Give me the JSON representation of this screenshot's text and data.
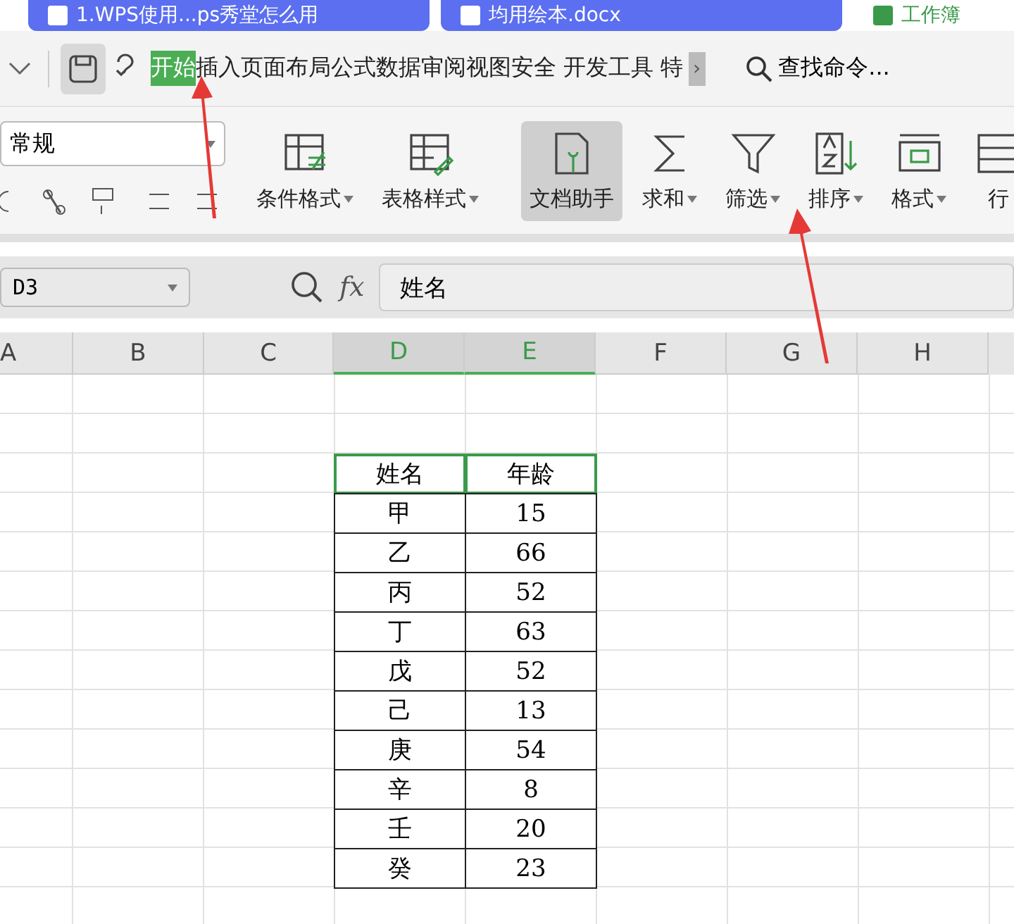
{
  "doc_tabs": [
    {
      "title": "1.WPS使用...ps秀堂怎么用",
      "kind": "writer",
      "selected": false
    },
    {
      "title": "均用绘本.docx",
      "kind": "writer",
      "selected": false
    },
    {
      "title": "工作簿",
      "kind": "sheet",
      "selected": true
    }
  ],
  "menu": [
    {
      "label": "开始",
      "selected": true
    },
    {
      "label": "插入",
      "selected": false
    },
    {
      "label": "页面布局",
      "selected": false
    },
    {
      "label": "公式",
      "selected": false
    },
    {
      "label": "数据",
      "selected": false
    },
    {
      "label": "审阅",
      "selected": false
    },
    {
      "label": "视图",
      "selected": false
    },
    {
      "label": "安全",
      "selected": false
    },
    {
      "label": "开发工具",
      "selected": false
    },
    {
      "label": "特",
      "selected": false
    }
  ],
  "more": "›",
  "search": "查找命令...",
  "number_format": "常规",
  "ribbon": [
    {
      "label": "条件格式",
      "kind": "cond",
      "dropdown": true,
      "selected": false
    },
    {
      "label": "表格样式",
      "kind": "style",
      "dropdown": true,
      "selected": false
    },
    {
      "label": "文档助手",
      "kind": "assistant",
      "dropdown": false,
      "selected": true
    },
    {
      "label": "求和",
      "kind": "sum",
      "dropdown": true,
      "selected": false
    },
    {
      "label": "筛选",
      "kind": "filter",
      "dropdown": true,
      "selected": false
    },
    {
      "label": "排序",
      "kind": "sort",
      "dropdown": true,
      "selected": false
    },
    {
      "label": "格式",
      "kind": "format",
      "dropdown": true,
      "selected": false
    },
    {
      "label": "行",
      "kind": "row",
      "dropdown": false,
      "selected": false
    }
  ],
  "name_box": "D3",
  "fx": "fx",
  "formula": "姓名",
  "columns": [
    {
      "label": "A",
      "selected": false
    },
    {
      "label": "B",
      "selected": false
    },
    {
      "label": "C",
      "selected": false
    },
    {
      "label": "D",
      "selected": true
    },
    {
      "label": "E",
      "selected": true
    },
    {
      "label": "F",
      "selected": false
    },
    {
      "label": "G",
      "selected": false
    },
    {
      "label": "H",
      "selected": false
    }
  ],
  "table": {
    "header": [
      "姓名",
      "年龄"
    ],
    "rows": [
      [
        "甲",
        "15"
      ],
      [
        "乙",
        "66"
      ],
      [
        "丙",
        "52"
      ],
      [
        "丁",
        "63"
      ],
      [
        "戊",
        "52"
      ],
      [
        "己",
        "13"
      ],
      [
        "庚",
        "54"
      ],
      [
        "辛",
        "8"
      ],
      [
        "壬",
        "20"
      ],
      [
        "癸",
        "23"
      ]
    ]
  }
}
